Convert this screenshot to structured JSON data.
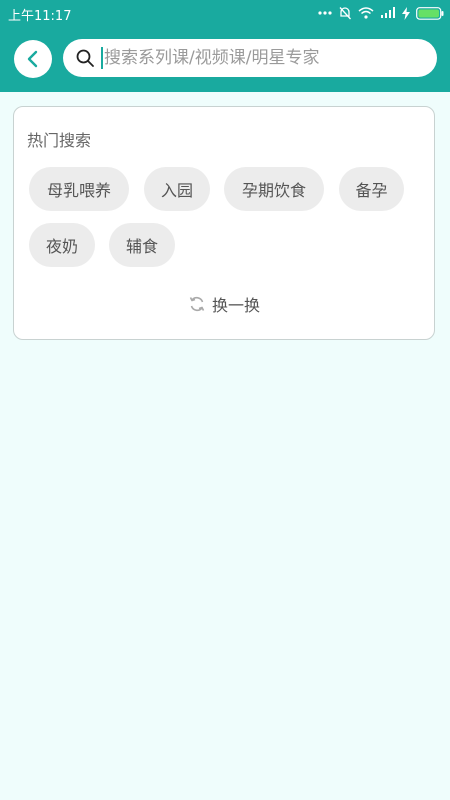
{
  "status_bar": {
    "time": "上午11:17"
  },
  "search": {
    "placeholder": "搜索系列课/视频课/明星专家",
    "value": ""
  },
  "hot": {
    "title": "热门搜索",
    "tags": [
      "母乳喂养",
      "入园",
      "孕期饮食",
      "备孕",
      "夜奶",
      "辅食"
    ],
    "refresh_label": "换一换"
  },
  "colors": {
    "accent": "#19aa9f",
    "background": "#effdfc",
    "tag_bg": "#ececec"
  },
  "icons": {
    "back": "chevron-left-icon",
    "search": "search-icon",
    "refresh": "refresh-icon"
  }
}
